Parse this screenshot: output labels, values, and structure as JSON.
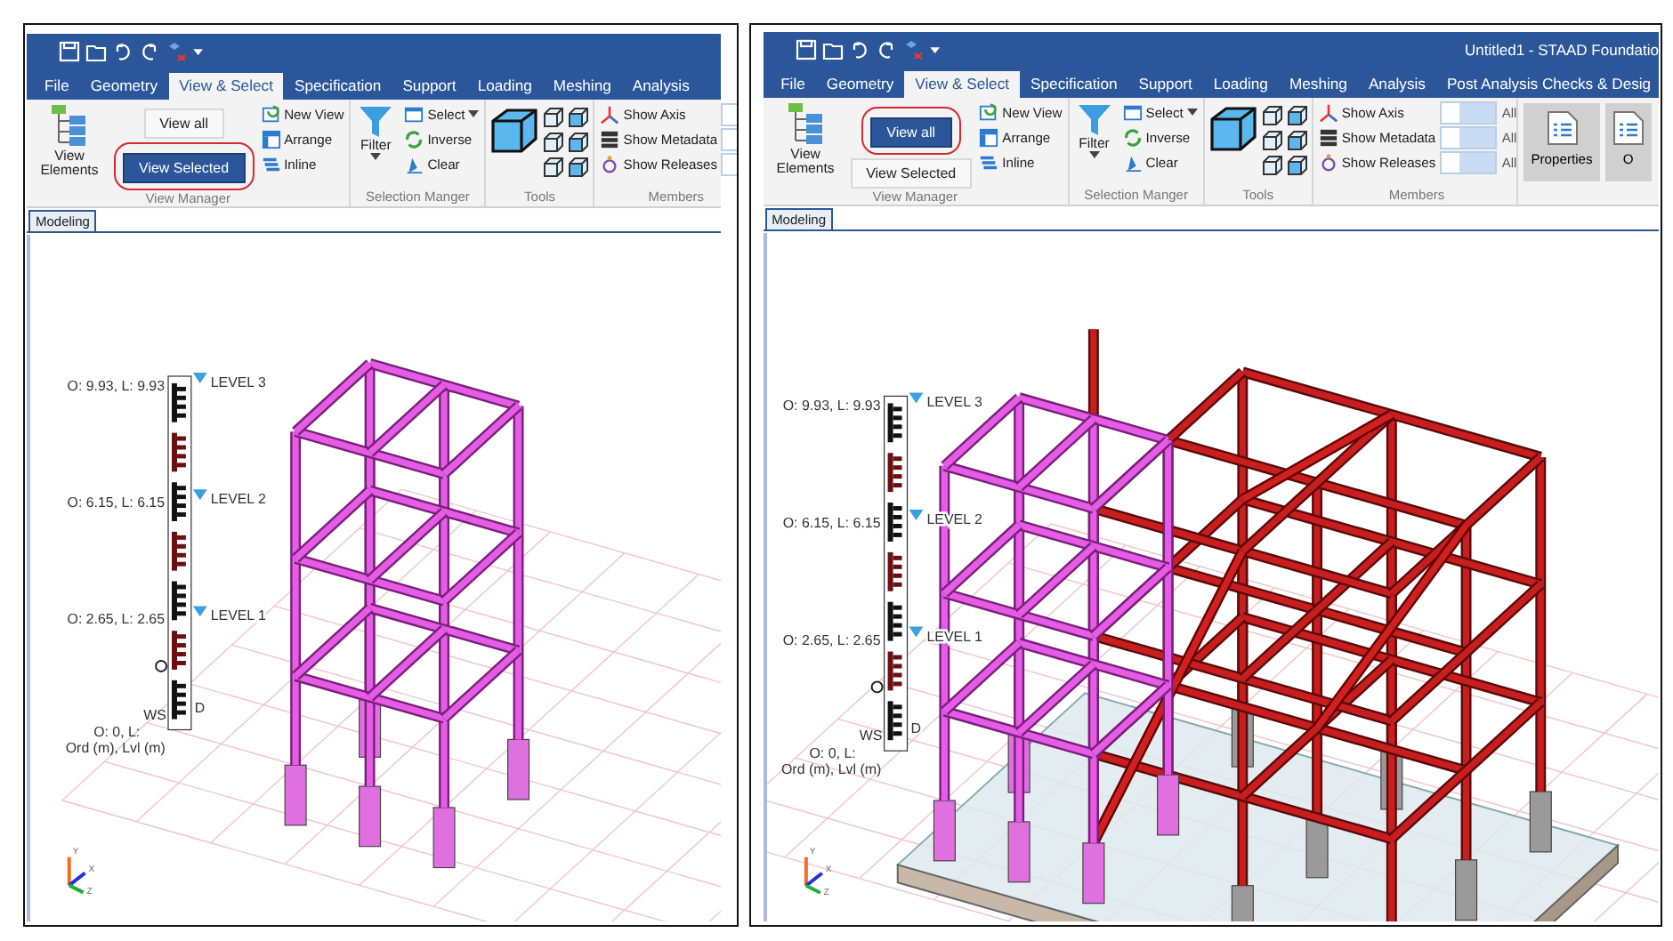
{
  "panels": [
    {
      "tabs": [
        {
          "label": "File",
          "selected": false
        },
        {
          "label": "Geometry",
          "selected": false
        },
        {
          "label": "View & Select",
          "selected": true
        },
        {
          "label": "Specification",
          "selected": false
        },
        {
          "label": "Support",
          "selected": false
        },
        {
          "label": "Loading",
          "selected": false
        },
        {
          "label": "Meshing",
          "selected": false
        },
        {
          "label": "Analysis",
          "selected": false
        }
      ],
      "view_manager": {
        "label": "View Manager",
        "elements_button": "View Elements",
        "buttons": [
          {
            "label": "View all",
            "active": false
          },
          {
            "label": "View Selected",
            "active": true
          }
        ],
        "actions": [
          "New View",
          "Arrange",
          "Inline"
        ]
      },
      "selection": {
        "label": "Selection Manger",
        "filter": "Filter",
        "actions": [
          {
            "label": "Select",
            "dropdown": true
          },
          {
            "label": "Inverse",
            "dropdown": false
          },
          {
            "label": "Clear",
            "dropdown": false
          }
        ]
      },
      "tools": {
        "label": "Tools"
      },
      "members": {
        "label": "Members",
        "items": [
          {
            "label": "Show Axis",
            "on": false
          },
          {
            "label": "Show Metadata",
            "on": false
          },
          {
            "label": "Show Releases",
            "on": false
          }
        ]
      },
      "doc_tab": "Modeling",
      "viewport": {
        "levels": [
          {
            "ordinate": "O: 9.93, L: 9.93",
            "name": "LEVEL 3"
          },
          {
            "ordinate": "O: 6.15, L: 6.15",
            "name": "LEVEL 2"
          },
          {
            "ordinate": "O: 2.65, L: 2.65",
            "name": "LEVEL 1"
          }
        ],
        "base": "O: 0, L:",
        "units": "Ord (m), Lvl (m)",
        "markers": [
          "WS",
          "D"
        ],
        "axes": [
          "Y",
          "X",
          "Z"
        ]
      }
    },
    {
      "title": "Untitled1 - STAAD Foundatio",
      "tabs": [
        {
          "label": "File",
          "selected": false
        },
        {
          "label": "Geometry",
          "selected": false
        },
        {
          "label": "View & Select",
          "selected": true
        },
        {
          "label": "Specification",
          "selected": false
        },
        {
          "label": "Support",
          "selected": false
        },
        {
          "label": "Loading",
          "selected": false
        },
        {
          "label": "Meshing",
          "selected": false
        },
        {
          "label": "Analysis",
          "selected": false
        },
        {
          "label": "Post Analysis Checks & Desig",
          "selected": false
        }
      ],
      "view_manager": {
        "label": "View Manager",
        "elements_button": "View Elements",
        "buttons": [
          {
            "label": "View all",
            "active": true
          },
          {
            "label": "View Selected",
            "active": false
          }
        ],
        "actions": [
          "New View",
          "Arrange",
          "Inline"
        ]
      },
      "selection": {
        "label": "Selection Manger",
        "filter": "Filter",
        "actions": [
          {
            "label": "Select",
            "dropdown": true
          },
          {
            "label": "Inverse",
            "dropdown": false
          },
          {
            "label": "Clear",
            "dropdown": false
          }
        ]
      },
      "tools": {
        "label": "Tools"
      },
      "members": {
        "label": "Members",
        "items": [
          {
            "label": "Show Axis",
            "on": false,
            "switch": "All"
          },
          {
            "label": "Show Metadata",
            "on": false,
            "switch": "All"
          },
          {
            "label": "Show Releases",
            "on": false,
            "switch": "All"
          }
        ]
      },
      "side_buttons": [
        {
          "label": "Properties"
        },
        {
          "label": "O"
        }
      ],
      "doc_tab": "Modeling",
      "viewport": {
        "levels": [
          {
            "ordinate": "O: 9.93, L: 9.93",
            "name": "LEVEL 3"
          },
          {
            "ordinate": "O: 6.15, L: 6.15",
            "name": "LEVEL 2"
          },
          {
            "ordinate": "O: 2.65, L: 2.65",
            "name": "LEVEL 1"
          }
        ],
        "base": "O: 0, L:",
        "units": "Ord (m), Lvl (m)",
        "markers": [
          "WS",
          "D"
        ],
        "axes": [
          "Y",
          "X",
          "Z"
        ]
      }
    }
  ]
}
